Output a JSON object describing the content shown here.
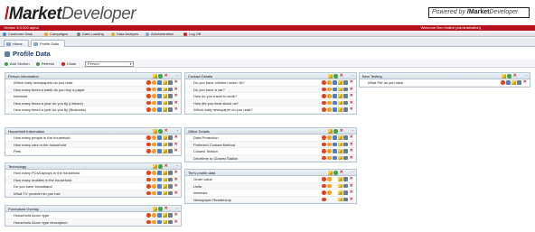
{
  "app": {
    "logo_slash": "/",
    "logo_bold": "Market",
    "logo_rest": "Developer",
    "powered_prefix": "Powered by ",
    "powered_slash": "/",
    "powered_bold": "Market",
    "powered_rest": "Developer",
    "version": "Version 5.0.002 alpha",
    "welcome": "Welcome  Ben Hallett (Administration)"
  },
  "menu": [
    {
      "label": "Customer Data",
      "icon": "customer-icon",
      "color": "#4a82c8"
    },
    {
      "label": "Campaigns",
      "icon": "campaigns-icon",
      "color": "#f0a020"
    },
    {
      "label": "Data Loading",
      "icon": "data-loading-icon",
      "color": "#6a7d8f"
    },
    {
      "label": "Data Analysis",
      "icon": "data-analysis-icon",
      "color": "#e0b030"
    },
    {
      "label": "Administration",
      "icon": "administration-icon",
      "color": "#8aa6c8"
    },
    {
      "label": "Log Off",
      "icon": "log-off-icon",
      "color": "#d0201a"
    }
  ],
  "tabs": [
    {
      "label": "Home"
    },
    {
      "label": "Profile Data"
    }
  ],
  "page": {
    "title": "Profile Data"
  },
  "toolbar": {
    "add_section": "Add Section",
    "refresh": "Refresh",
    "close": "Close",
    "select_value": "Person"
  },
  "panels": [
    {
      "title": "Person Information",
      "rows": [
        {
          "label": "Which daily newspapers do you read",
          "icons": [
            "red",
            "orange",
            "blue",
            "pencil",
            "people",
            "x"
          ]
        },
        {
          "label": "How many times a week do you buy a paper",
          "icons": [
            "red",
            "orange",
            "blue",
            "pencil",
            "people",
            "x"
          ]
        },
        {
          "label": "Interests",
          "icons": [
            "red",
            "orange",
            "blue",
            "pencil",
            "people",
            "x"
          ]
        },
        {
          "label": "How many times a year do you fly (Leisure)",
          "icons": [
            "red",
            "orange",
            "blue",
            "pencil",
            "people",
            "x"
          ]
        },
        {
          "label": "How many times a year do you fly (Business)",
          "icons": [
            "red",
            "orange",
            "blue",
            "pencil",
            "people",
            "x"
          ]
        }
      ]
    },
    {
      "title": "Household Information",
      "rows": [
        {
          "label": "How many people in the household",
          "icons": [
            "red",
            "orange",
            "blue",
            "pencil",
            "people",
            "x"
          ]
        },
        {
          "label": "How many cars in the household",
          "icons": [
            "red",
            "orange",
            "blue",
            "pencil",
            "people",
            "x"
          ]
        },
        {
          "label": "Pets",
          "icons": [
            "red",
            "orange",
            "blue",
            "pencil",
            "people",
            "x"
          ]
        }
      ]
    },
    {
      "title": "Technology",
      "rows": [
        {
          "label": "How many PCs/Laptops in the household",
          "icons": [
            "red",
            "orange",
            "blue",
            "pencil",
            "people",
            "x"
          ]
        },
        {
          "label": "How many mobiles in the household",
          "icons": [
            "red",
            "orange",
            "blue",
            "pencil",
            "people",
            "x"
          ]
        },
        {
          "label": "Do you have broadband",
          "icons": [
            "red",
            "orange",
            "blue",
            "pencil",
            "people",
            "x"
          ]
        },
        {
          "label": "What TV provider do you use",
          "icons": [
            "red",
            "orange",
            "blue",
            "pencil",
            "people",
            "x"
          ]
        }
      ]
    },
    {
      "title": "Purchased Overlay",
      "rows": [
        {
          "label": "Household Acorn type",
          "icons": [
            "red",
            "orange",
            "blue",
            "pencil",
            "people",
            "x"
          ]
        },
        {
          "label": "Household Acorn type description",
          "icons": [
            "red",
            "orange",
            "blue",
            "pencil",
            "people",
            "x"
          ]
        }
      ]
    },
    {
      "title": "Contact Details",
      "rows": [
        {
          "label": "Do you have children under 16?",
          "icons": [
            "red",
            "orange",
            "blue",
            "pencil",
            "people",
            "x"
          ]
        },
        {
          "label": "Do you have a car?",
          "icons": [
            "red",
            "orange",
            "blue",
            "pencil",
            "people",
            "x"
          ]
        },
        {
          "label": "How do you travel to work?",
          "icons": [
            "red",
            "orange",
            "blue",
            "pencil",
            "people",
            "x"
          ]
        },
        {
          "label": "How did you hear about us?",
          "icons": [
            "red",
            "orange",
            "blue",
            "pencil",
            "people",
            "x"
          ]
        },
        {
          "label": "Which daily newspaper do you read?",
          "icons": [
            "red",
            "orange",
            "blue",
            "pencil",
            "people",
            "x"
          ]
        }
      ]
    },
    {
      "title": "Office Details",
      "rows": [
        {
          "label": "Data Protection",
          "icons": [
            "red",
            "orange",
            "blue",
            "pencil",
            "people",
            "x"
          ]
        },
        {
          "label": "Preferred Contact Method",
          "icons": [
            "red",
            "orange",
            "blue",
            "pencil",
            "people",
            "x"
          ]
        },
        {
          "label": "Closest Station",
          "icons": [
            "red",
            "orange",
            "blue",
            "pencil",
            "people",
            "x"
          ]
        },
        {
          "label": "Drivetime to Closest Station",
          "icons": [
            "red",
            "orange",
            "blue",
            "pencil",
            "people",
            "x"
          ]
        }
      ]
    },
    {
      "title": "Tim's profile data",
      "rows": [
        {
          "label": "Order value",
          "icons": [
            "red",
            "orange",
            "blank",
            "pencil",
            "people",
            "x"
          ]
        },
        {
          "label": "Units",
          "icons": [
            "red",
            "orange",
            "blank",
            "pencil",
            "people",
            "x"
          ]
        },
        {
          "label": "Interests",
          "icons": [
            "red",
            "orange",
            "blank",
            "pencil",
            "people",
            "x"
          ]
        },
        {
          "label": "Newspaper Readership",
          "icons": [
            "red",
            "blank",
            "blank",
            "pencil",
            "people",
            "x"
          ]
        }
      ]
    },
    {
      "title": "Beni Testing",
      "rows": [
        {
          "label": "What Pet do you have",
          "icons": [
            "red",
            "blue",
            "pencil",
            "people",
            "x"
          ]
        }
      ]
    }
  ]
}
